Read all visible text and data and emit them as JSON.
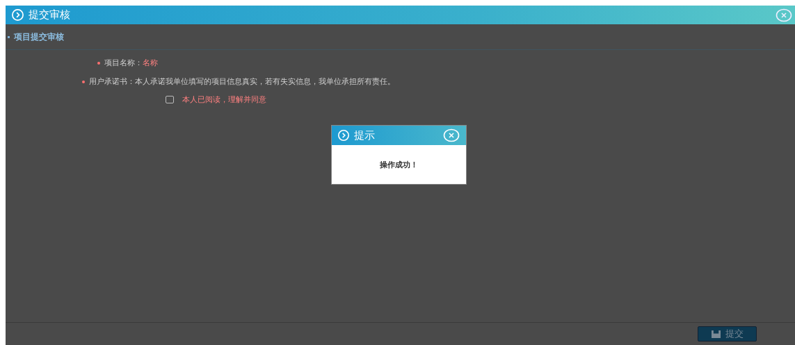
{
  "window": {
    "title": "提交审核"
  },
  "section": {
    "title": "项目提交审核"
  },
  "form": {
    "fields": [
      {
        "label": "项目名称：",
        "value": "名称",
        "kind": "value"
      },
      {
        "label": "用户承诺书：",
        "value": "本人承诺我单位填写的项目信息真实，若有失实信息，我单位承担所有责任。",
        "kind": "text"
      }
    ],
    "agreement": {
      "label": "本人已阅读，理解并同意",
      "checked": false
    }
  },
  "dialog": {
    "title": "提示",
    "message": "操作成功！"
  },
  "buttons": [
    {
      "label": "提交"
    }
  ]
}
